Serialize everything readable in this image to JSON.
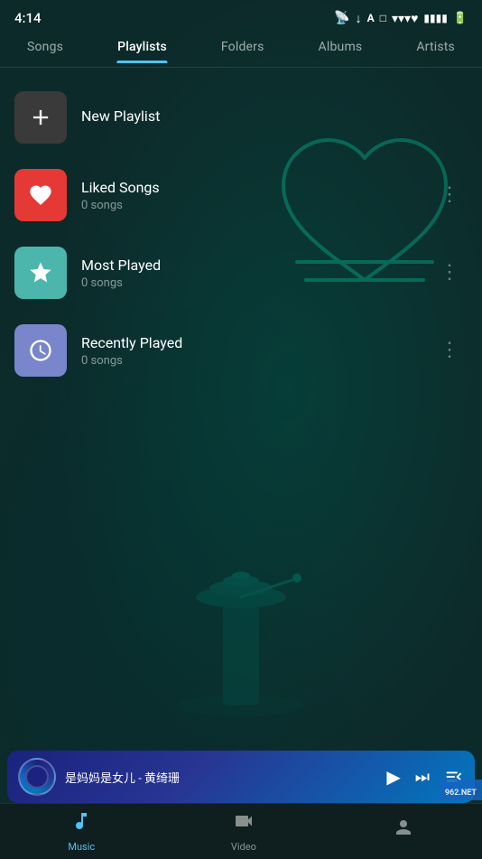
{
  "statusBar": {
    "time": "4:14",
    "icons": [
      "cast",
      "download",
      "text",
      "square",
      "wifi",
      "signal",
      "battery"
    ]
  },
  "tabs": [
    {
      "id": "songs",
      "label": "Songs",
      "active": false
    },
    {
      "id": "playlists",
      "label": "Playlists",
      "active": true
    },
    {
      "id": "folders",
      "label": "Folders",
      "active": false
    },
    {
      "id": "albums",
      "label": "Albums",
      "active": false
    },
    {
      "id": "artists",
      "label": "Artists",
      "active": false
    }
  ],
  "playlists": [
    {
      "id": "new",
      "icon": "plus",
      "iconColor": "dark-gray",
      "name": "New Playlist",
      "songs": null,
      "showMore": false
    },
    {
      "id": "liked",
      "icon": "heart",
      "iconColor": "red",
      "name": "Liked Songs",
      "songs": "0 songs",
      "showMore": true
    },
    {
      "id": "most-played",
      "icon": "star",
      "iconColor": "teal",
      "name": "Most Played",
      "songs": "0 songs",
      "showMore": true
    },
    {
      "id": "recently-played",
      "icon": "clock",
      "iconColor": "purple",
      "name": "Recently Played",
      "songs": "0 songs",
      "showMore": true
    }
  ],
  "nowPlaying": {
    "title": "是妈妈是女儿 - 黄绮珊",
    "playIcon": "▶",
    "nextIcon": "⏭",
    "listIcon": "≡"
  },
  "bottomNav": [
    {
      "id": "music",
      "label": "Music",
      "icon": "music",
      "active": true
    },
    {
      "id": "video",
      "label": "Video",
      "icon": "video",
      "active": false
    },
    {
      "id": "profile",
      "label": "",
      "icon": "profile",
      "active": false
    }
  ]
}
